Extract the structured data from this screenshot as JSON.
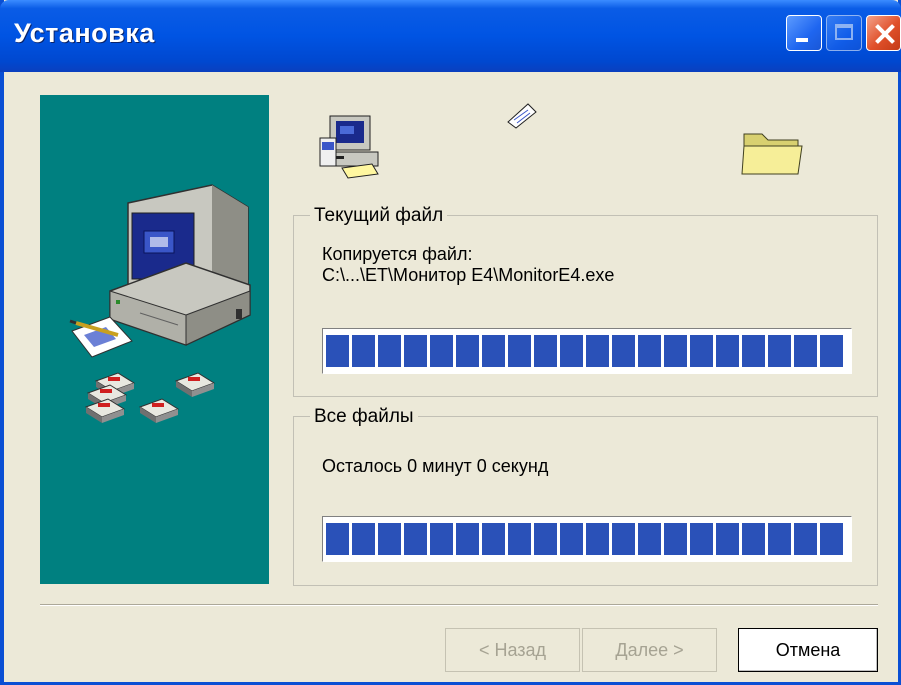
{
  "window": {
    "title": "Установка",
    "controls": [
      "minimize",
      "maximize",
      "close"
    ]
  },
  "current_file": {
    "group_label": "Текущий файл",
    "status_line": "Копируется файл:",
    "path": "C:\\...\\ET\\Монитор E4\\MonitorE4.exe",
    "progress": 1.0
  },
  "all_files": {
    "group_label": "Все файлы",
    "status_line": "Осталось 0 минут 0 секунд",
    "progress": 1.0
  },
  "buttons": {
    "back": "< Назад",
    "next": "Далее >",
    "cancel": "Отмена"
  },
  "icons": {
    "side_panel": "computer-with-floppies-illustration",
    "source": "computer-setup-icon",
    "flying": "flying-paper-icon",
    "destination": "folder-icon"
  },
  "colors": {
    "titlebar": "#0054e3",
    "side_panel": "#008080",
    "progress_fill": "#2a51b8",
    "window_bg": "#ece9d8"
  }
}
